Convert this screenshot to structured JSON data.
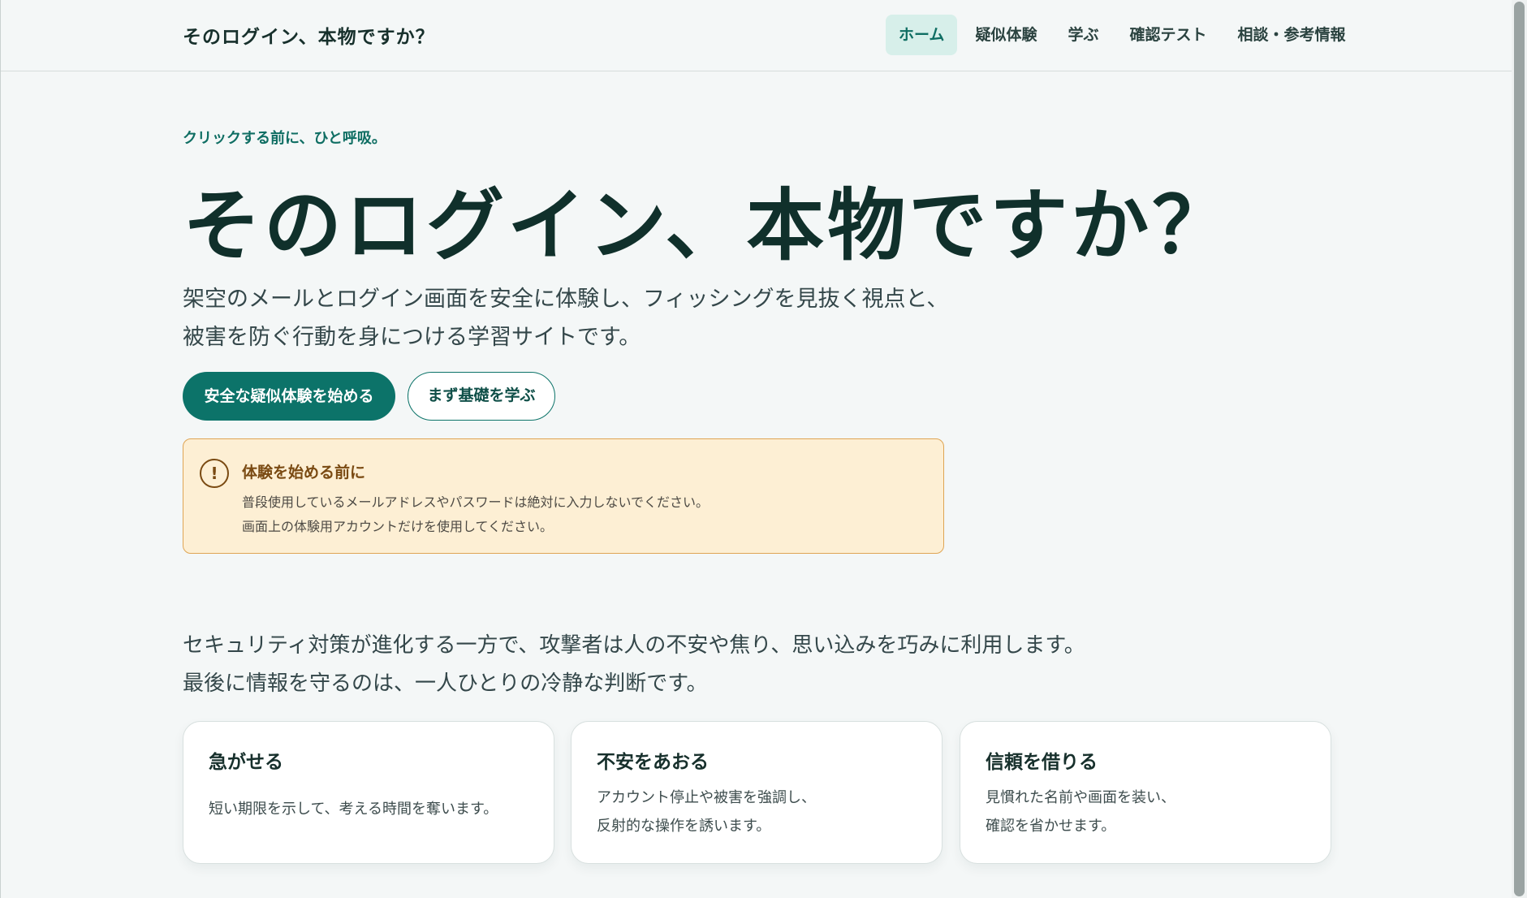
{
  "header": {
    "brand": "そのログイン、本物ですか？",
    "nav": [
      {
        "label": "ホーム",
        "active": true
      },
      {
        "label": "疑似体験",
        "active": false
      },
      {
        "label": "学ぶ",
        "active": false
      },
      {
        "label": "確認テスト",
        "active": false
      },
      {
        "label": "相談・参考情報",
        "active": false
      }
    ]
  },
  "hero": {
    "eyebrow": "クリックする前に、ひと呼吸。",
    "title": "そのログイン、本物ですか？",
    "lead_line1": "架空のメールとログイン画面を安全に体験し、フィッシングを見抜く視点と、",
    "lead_line2": "被害を防ぐ行動を身につける学習サイトです。",
    "primary_button": "安全な疑似体験を始める",
    "secondary_button": "まず基礎を学ぶ"
  },
  "notice": {
    "icon": "!",
    "title": "体験を始める前に",
    "line1": "普段使用しているメールアドレスやパスワードは絶対に入力しないでください。",
    "line2": "画面上の体験用アカウントだけを使用してください。"
  },
  "intro": {
    "line1": "セキュリティ対策が進化する一方で、攻撃者は人の不安や焦り、思い込みを巧みに利用します。",
    "line2": "最後に情報を守るのは、一人ひとりの冷静な判断です。"
  },
  "cards": [
    {
      "title": "急がせる",
      "line1": "短い期限を示して、考える時間を奪います。",
      "line2": ""
    },
    {
      "title": "不安をあおる",
      "line1": "アカウント停止や被害を強調し、",
      "line2": "反射的な操作を誘います。"
    },
    {
      "title": "信頼を借りる",
      "line1": "見慣れた名前や画面を装い、",
      "line2": "確認を省かせます。"
    }
  ],
  "colors": {
    "accent": "#0c7369",
    "nav_active_bg": "#d7efea",
    "notice_bg": "#fdefd4",
    "notice_border": "#dfa554"
  }
}
